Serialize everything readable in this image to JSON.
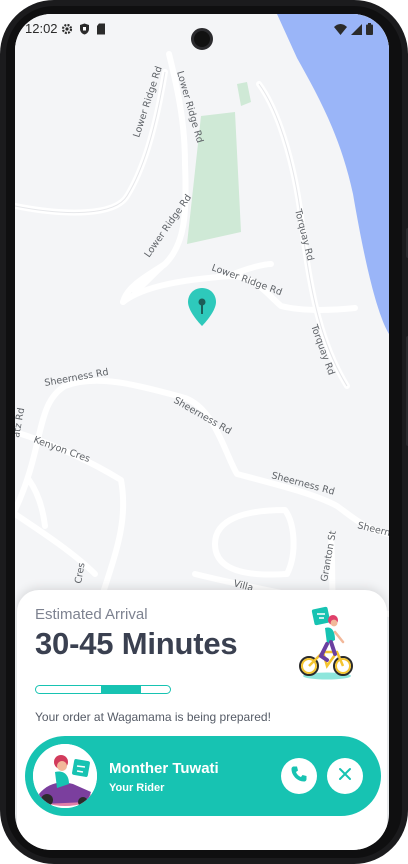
{
  "status_bar": {
    "time": "12:02",
    "left_icons": [
      "gear-icon",
      "shield-icon",
      "sim-card-icon"
    ],
    "right_icons": [
      "wifi-icon",
      "signal-icon",
      "battery-icon"
    ]
  },
  "map": {
    "street_labels": [
      "Lower Ridge Rd",
      "Lower Ridge Rd",
      "Lower Ridge Rd",
      "Lower Ridge Rd",
      "Torquay Rd",
      "Torquay Rd",
      "Sheerness Rd",
      "Sheerness Rd",
      "Sheerness Rd",
      "Sheern",
      "Kenyon Cres",
      "Granton St",
      "Villa",
      "Cres",
      "atz Rd"
    ],
    "marker": "location-pin-icon",
    "colors": {
      "water": "#9ab5f8",
      "park": "#cfe9d6",
      "road": "#ffffff",
      "marker": "#2ec9bb"
    }
  },
  "delivery": {
    "eta_label": "Estimated Arrival",
    "eta_value": "30-45 Minutes",
    "progress_segment": 2,
    "progress_segments_total": 3,
    "status_message": "Your order at Wagamama is being prepared!",
    "illustration": "delivery-bike-icon"
  },
  "rider": {
    "name": "Monther Tuwati",
    "role": "Your Rider",
    "call_icon": "phone-icon",
    "close_icon": "close-icon"
  },
  "colors": {
    "accent": "#17c3b2",
    "title": "#3a4050"
  }
}
